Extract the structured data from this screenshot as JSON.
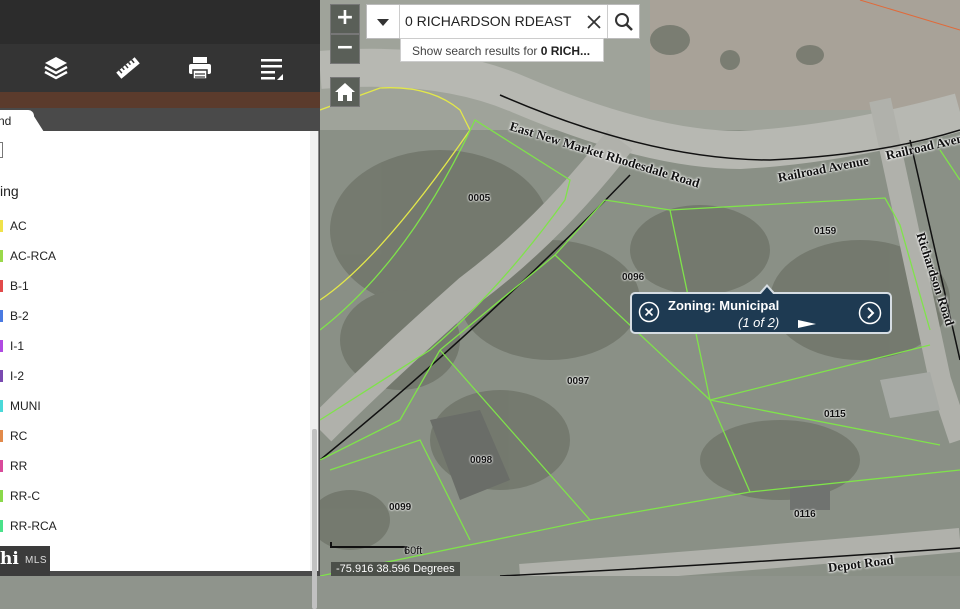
{
  "map": {
    "parcels": [
      "0005",
      "0096",
      "0159",
      "0097",
      "0115",
      "0098",
      "0099",
      "0116"
    ],
    "roads": [
      "East New Market Rhodesdale Road",
      "Railroad Avenue",
      "Railroad Avenue",
      "Richardson Road",
      "Depot Road"
    ],
    "colors": {
      "parcel_line": "#7fe34a",
      "highlight_line": "#e3e84a",
      "road_line": "#111111",
      "popup_bg": "#1e3a52"
    }
  },
  "controls": {
    "zoom_in": "+",
    "zoom_out": "−",
    "home_icon": "home-icon"
  },
  "search": {
    "value": "0 RICHARDSON RDEAST",
    "suggestion_prefix": "Show search results for ",
    "suggestion_term": "0 RICH..."
  },
  "popup": {
    "title": "Zoning: Municipal",
    "count": "(1 of 2)"
  },
  "scale": {
    "label": "60ft"
  },
  "coordinates": {
    "text": "-75.916 38.596 Degrees"
  },
  "toolbar": {
    "icons": [
      "layers-icon",
      "measure-icon",
      "print-icon",
      "list-icon"
    ]
  },
  "legend": {
    "tab_label": "nd",
    "check_label": "",
    "heading": "ing",
    "items": [
      {
        "label": "AC",
        "color": "#f0e24a"
      },
      {
        "label": "AC-RCA",
        "color": "#9ad94a"
      },
      {
        "label": "B-1",
        "color": "#e24a4a"
      },
      {
        "label": "B-2",
        "color": "#4a7ae2"
      },
      {
        "label": "I-1",
        "color": "#b04ae2"
      },
      {
        "label": "I-2",
        "color": "#7a4ab0"
      },
      {
        "label": "MUNI",
        "color": "#4ad9d9"
      },
      {
        "label": "RC",
        "color": "#e28a4a"
      },
      {
        "label": "RR",
        "color": "#d94a9a"
      },
      {
        "label": "RR-C",
        "color": "#8ad94a"
      },
      {
        "label": "RR-RCA",
        "color": "#4ae28a"
      }
    ]
  },
  "logo": {
    "mark": "hi",
    "text": "MLS"
  }
}
